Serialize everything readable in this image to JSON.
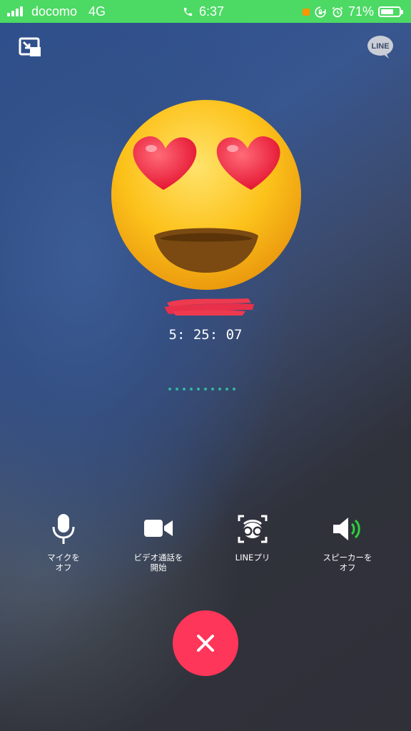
{
  "status_bar": {
    "carrier": "docomo",
    "network": "4G",
    "time": "6:37",
    "battery_percent": "71%",
    "battery_level": 0.71,
    "background_color": "#4cd964"
  },
  "call": {
    "duration": "5: 25: 07",
    "caller_name_redacted": true
  },
  "controls": [
    {
      "id": "mic",
      "label": "マイクを\nオフ",
      "icon": "microphone-icon"
    },
    {
      "id": "video",
      "label": "ビデオ通話を\n開始",
      "icon": "video-camera-icon"
    },
    {
      "id": "filter",
      "label": "LINEプリ",
      "icon": "face-filter-icon"
    },
    {
      "id": "speaker",
      "label": "スピーカーを\nオフ",
      "icon": "speaker-icon"
    }
  ],
  "colors": {
    "end_call": "#fe3659",
    "accent_dots": "#2fb9a2",
    "speaker_active": "#2ed13b"
  },
  "icons": {
    "minimize": "minimize-window-icon",
    "line_logo": "LINE",
    "end_call": "close-icon",
    "avatar": "heart-eyes-emoji"
  }
}
